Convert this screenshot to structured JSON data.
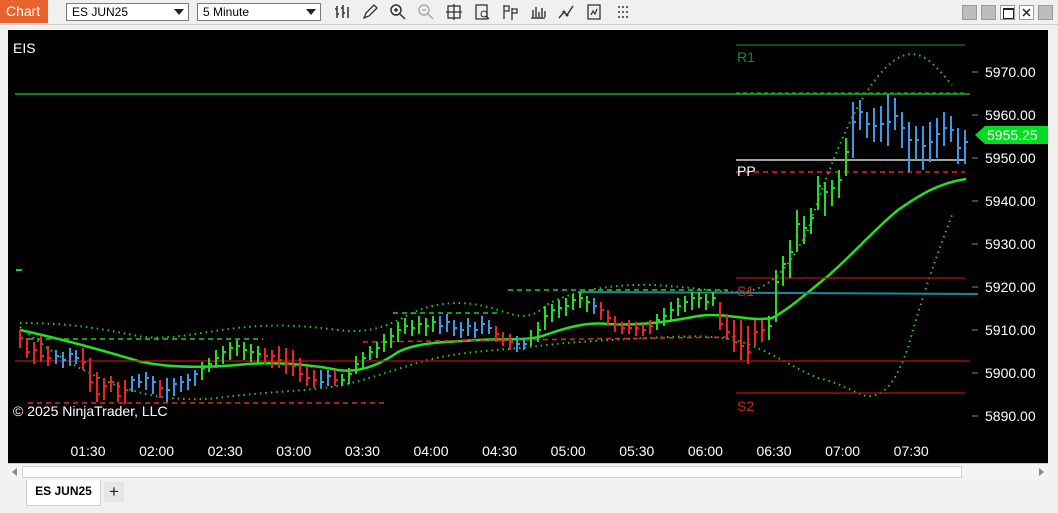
{
  "toolbar": {
    "chart_label": "Chart",
    "instrument": "ES JUN25",
    "interval": "5 Minute",
    "icons": [
      "bar-type-icon",
      "draw-pencil-icon",
      "zoom-in-icon",
      "zoom-out-icon",
      "crosshair-icon",
      "data-box-icon",
      "indicators-icon",
      "strategies-icon",
      "drawing-tools-icon",
      "properties-icon",
      "more-icon"
    ]
  },
  "chart": {
    "indicator_label": "EIS",
    "copyright": "© 2025 NinjaTrader, LLC",
    "current_price": "5955.25",
    "pivot_labels": {
      "r1": "R1",
      "pp": "PP",
      "s1": "S1",
      "s2": "S2"
    },
    "y_ticks": [
      "5970.00",
      "5960.00",
      "5950.00",
      "5940.00",
      "5930.00",
      "5920.00",
      "5910.00",
      "5900.00",
      "5890.00"
    ],
    "x_ticks": [
      "01:30",
      "02:00",
      "02:30",
      "03:00",
      "03:30",
      "04:00",
      "04:30",
      "05:00",
      "05:30",
      "06:00",
      "06:30",
      "07:00",
      "07:30"
    ],
    "colors": {
      "up": "#22dd22",
      "down": "#ee2222",
      "neutral": "#3a9ae8",
      "ma": "#22e022",
      "pp": "#ffffff",
      "price_tag": "#00dd22"
    }
  },
  "tabs": [
    {
      "label": "ES JUN25"
    }
  ],
  "add_tab_label": "+"
}
